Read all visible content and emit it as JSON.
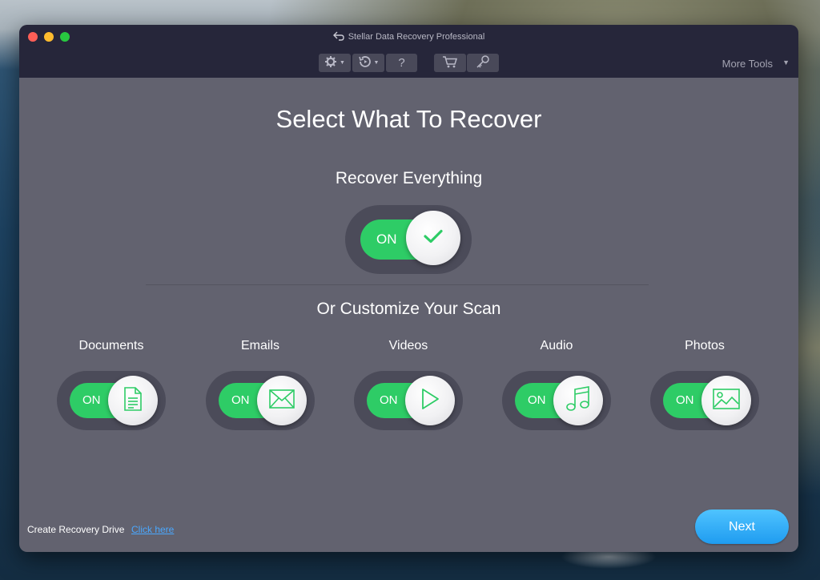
{
  "window": {
    "title": "Stellar Data Recovery Professional",
    "more_tools": "More Tools",
    "toolbar": {
      "settings": "gear-icon",
      "history": "history-icon",
      "help": "?",
      "cart": "cart-icon",
      "key": "key-icon"
    }
  },
  "main": {
    "title": "Select What To Recover",
    "recover_everything": "Recover Everything",
    "recover_everything_state": "ON",
    "customize": "Or Customize Your Scan",
    "categories": [
      {
        "label": "Documents",
        "state": "ON",
        "icon": "document-icon"
      },
      {
        "label": "Emails",
        "state": "ON",
        "icon": "envelope-icon"
      },
      {
        "label": "Videos",
        "state": "ON",
        "icon": "play-icon"
      },
      {
        "label": "Audio",
        "state": "ON",
        "icon": "music-note-icon"
      },
      {
        "label": "Photos",
        "state": "ON",
        "icon": "image-icon"
      }
    ]
  },
  "footer": {
    "recovery_drive_label": "Create Recovery Drive",
    "recovery_drive_link": "Click here",
    "next_label": "Next"
  },
  "colors": {
    "toggle_on": "#2ecc66",
    "panel": "#62626f",
    "titlebar": "#26263a",
    "accent": "#1f9cf0"
  }
}
